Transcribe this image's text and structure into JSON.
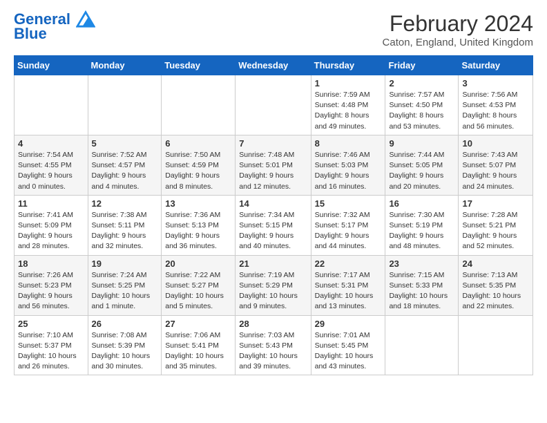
{
  "header": {
    "logo_line1": "General",
    "logo_line2": "Blue",
    "month_title": "February 2024",
    "location": "Caton, England, United Kingdom"
  },
  "weekdays": [
    "Sunday",
    "Monday",
    "Tuesday",
    "Wednesday",
    "Thursday",
    "Friday",
    "Saturday"
  ],
  "weeks": [
    [
      {
        "day": "",
        "sunrise": "",
        "sunset": "",
        "daylight": ""
      },
      {
        "day": "",
        "sunrise": "",
        "sunset": "",
        "daylight": ""
      },
      {
        "day": "",
        "sunrise": "",
        "sunset": "",
        "daylight": ""
      },
      {
        "day": "",
        "sunrise": "",
        "sunset": "",
        "daylight": ""
      },
      {
        "day": "1",
        "sunrise": "Sunrise: 7:59 AM",
        "sunset": "Sunset: 4:48 PM",
        "daylight": "Daylight: 8 hours and 49 minutes."
      },
      {
        "day": "2",
        "sunrise": "Sunrise: 7:57 AM",
        "sunset": "Sunset: 4:50 PM",
        "daylight": "Daylight: 8 hours and 53 minutes."
      },
      {
        "day": "3",
        "sunrise": "Sunrise: 7:56 AM",
        "sunset": "Sunset: 4:53 PM",
        "daylight": "Daylight: 8 hours and 56 minutes."
      }
    ],
    [
      {
        "day": "4",
        "sunrise": "Sunrise: 7:54 AM",
        "sunset": "Sunset: 4:55 PM",
        "daylight": "Daylight: 9 hours and 0 minutes."
      },
      {
        "day": "5",
        "sunrise": "Sunrise: 7:52 AM",
        "sunset": "Sunset: 4:57 PM",
        "daylight": "Daylight: 9 hours and 4 minutes."
      },
      {
        "day": "6",
        "sunrise": "Sunrise: 7:50 AM",
        "sunset": "Sunset: 4:59 PM",
        "daylight": "Daylight: 9 hours and 8 minutes."
      },
      {
        "day": "7",
        "sunrise": "Sunrise: 7:48 AM",
        "sunset": "Sunset: 5:01 PM",
        "daylight": "Daylight: 9 hours and 12 minutes."
      },
      {
        "day": "8",
        "sunrise": "Sunrise: 7:46 AM",
        "sunset": "Sunset: 5:03 PM",
        "daylight": "Daylight: 9 hours and 16 minutes."
      },
      {
        "day": "9",
        "sunrise": "Sunrise: 7:44 AM",
        "sunset": "Sunset: 5:05 PM",
        "daylight": "Daylight: 9 hours and 20 minutes."
      },
      {
        "day": "10",
        "sunrise": "Sunrise: 7:43 AM",
        "sunset": "Sunset: 5:07 PM",
        "daylight": "Daylight: 9 hours and 24 minutes."
      }
    ],
    [
      {
        "day": "11",
        "sunrise": "Sunrise: 7:41 AM",
        "sunset": "Sunset: 5:09 PM",
        "daylight": "Daylight: 9 hours and 28 minutes."
      },
      {
        "day": "12",
        "sunrise": "Sunrise: 7:38 AM",
        "sunset": "Sunset: 5:11 PM",
        "daylight": "Daylight: 9 hours and 32 minutes."
      },
      {
        "day": "13",
        "sunrise": "Sunrise: 7:36 AM",
        "sunset": "Sunset: 5:13 PM",
        "daylight": "Daylight: 9 hours and 36 minutes."
      },
      {
        "day": "14",
        "sunrise": "Sunrise: 7:34 AM",
        "sunset": "Sunset: 5:15 PM",
        "daylight": "Daylight: 9 hours and 40 minutes."
      },
      {
        "day": "15",
        "sunrise": "Sunrise: 7:32 AM",
        "sunset": "Sunset: 5:17 PM",
        "daylight": "Daylight: 9 hours and 44 minutes."
      },
      {
        "day": "16",
        "sunrise": "Sunrise: 7:30 AM",
        "sunset": "Sunset: 5:19 PM",
        "daylight": "Daylight: 9 hours and 48 minutes."
      },
      {
        "day": "17",
        "sunrise": "Sunrise: 7:28 AM",
        "sunset": "Sunset: 5:21 PM",
        "daylight": "Daylight: 9 hours and 52 minutes."
      }
    ],
    [
      {
        "day": "18",
        "sunrise": "Sunrise: 7:26 AM",
        "sunset": "Sunset: 5:23 PM",
        "daylight": "Daylight: 9 hours and 56 minutes."
      },
      {
        "day": "19",
        "sunrise": "Sunrise: 7:24 AM",
        "sunset": "Sunset: 5:25 PM",
        "daylight": "Daylight: 10 hours and 1 minute."
      },
      {
        "day": "20",
        "sunrise": "Sunrise: 7:22 AM",
        "sunset": "Sunset: 5:27 PM",
        "daylight": "Daylight: 10 hours and 5 minutes."
      },
      {
        "day": "21",
        "sunrise": "Sunrise: 7:19 AM",
        "sunset": "Sunset: 5:29 PM",
        "daylight": "Daylight: 10 hours and 9 minutes."
      },
      {
        "day": "22",
        "sunrise": "Sunrise: 7:17 AM",
        "sunset": "Sunset: 5:31 PM",
        "daylight": "Daylight: 10 hours and 13 minutes."
      },
      {
        "day": "23",
        "sunrise": "Sunrise: 7:15 AM",
        "sunset": "Sunset: 5:33 PM",
        "daylight": "Daylight: 10 hours and 18 minutes."
      },
      {
        "day": "24",
        "sunrise": "Sunrise: 7:13 AM",
        "sunset": "Sunset: 5:35 PM",
        "daylight": "Daylight: 10 hours and 22 minutes."
      }
    ],
    [
      {
        "day": "25",
        "sunrise": "Sunrise: 7:10 AM",
        "sunset": "Sunset: 5:37 PM",
        "daylight": "Daylight: 10 hours and 26 minutes."
      },
      {
        "day": "26",
        "sunrise": "Sunrise: 7:08 AM",
        "sunset": "Sunset: 5:39 PM",
        "daylight": "Daylight: 10 hours and 30 minutes."
      },
      {
        "day": "27",
        "sunrise": "Sunrise: 7:06 AM",
        "sunset": "Sunset: 5:41 PM",
        "daylight": "Daylight: 10 hours and 35 minutes."
      },
      {
        "day": "28",
        "sunrise": "Sunrise: 7:03 AM",
        "sunset": "Sunset: 5:43 PM",
        "daylight": "Daylight: 10 hours and 39 minutes."
      },
      {
        "day": "29",
        "sunrise": "Sunrise: 7:01 AM",
        "sunset": "Sunset: 5:45 PM",
        "daylight": "Daylight: 10 hours and 43 minutes."
      },
      {
        "day": "",
        "sunrise": "",
        "sunset": "",
        "daylight": ""
      },
      {
        "day": "",
        "sunrise": "",
        "sunset": "",
        "daylight": ""
      }
    ]
  ]
}
